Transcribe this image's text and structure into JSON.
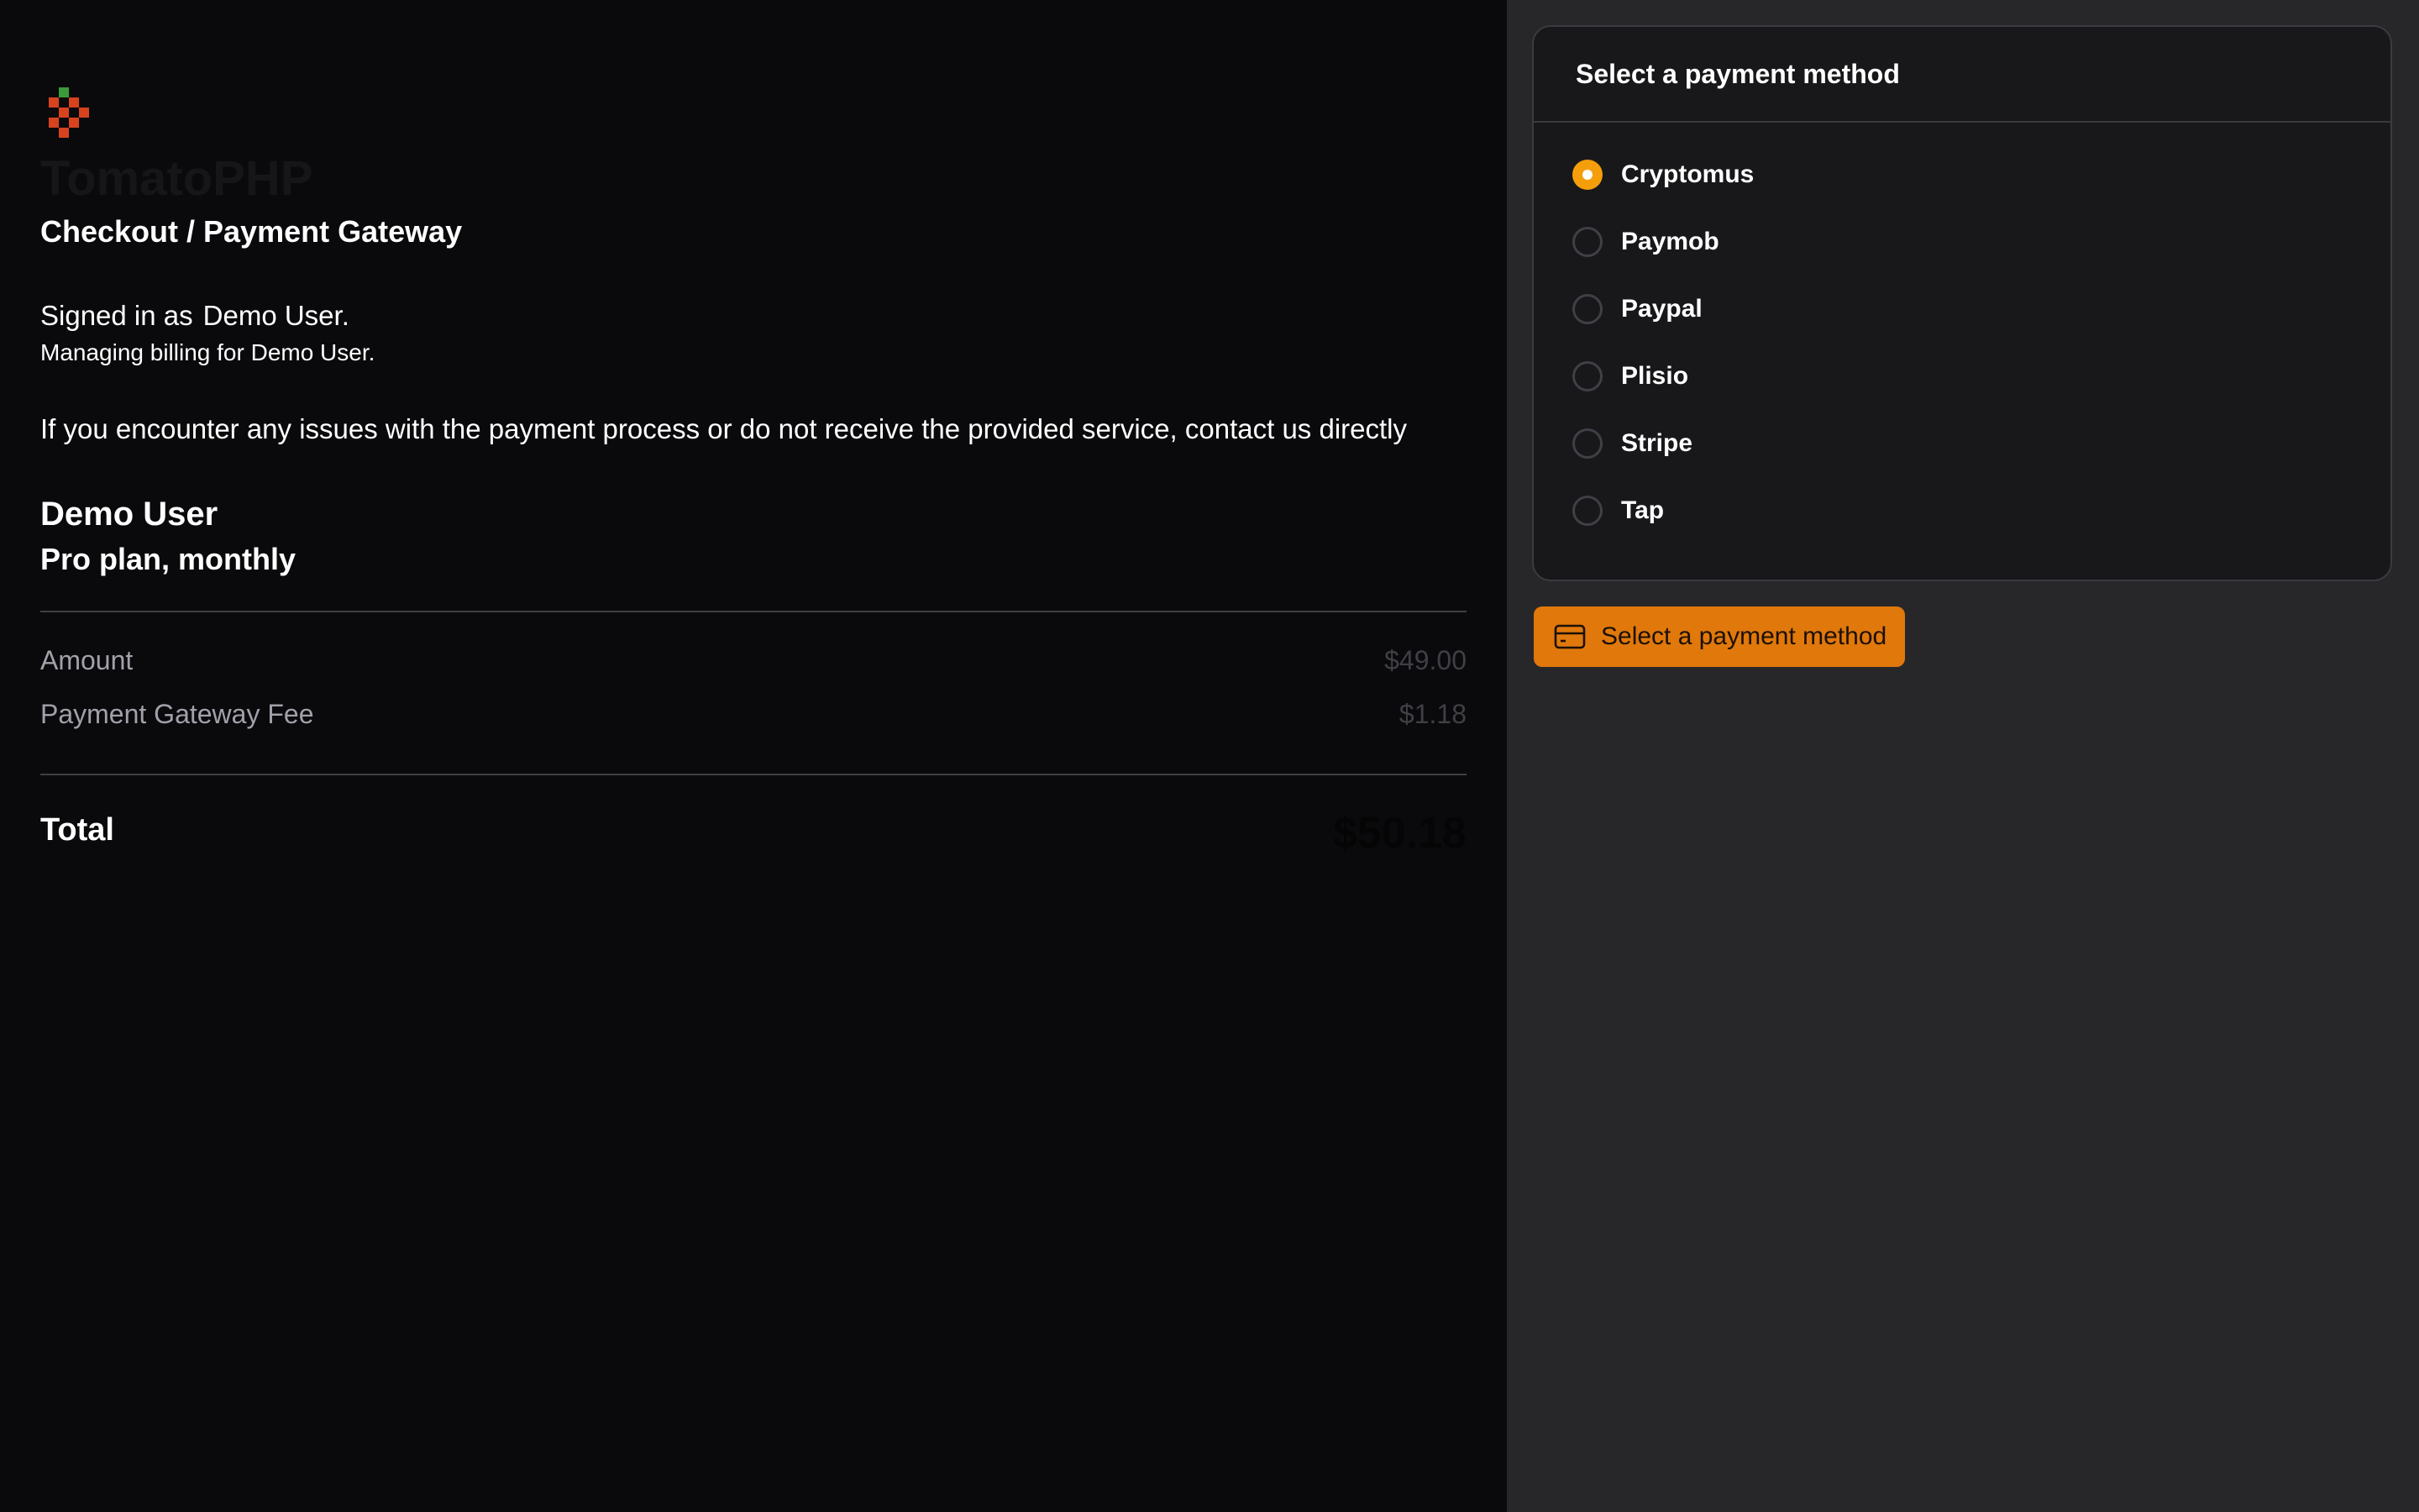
{
  "app": {
    "brand": "TomatoPHP",
    "logo_icon": "tomato-pixel-logo-icon",
    "page_title": "Checkout / Payment Gateway"
  },
  "account": {
    "signed_in_prefix": "Signed in as",
    "signed_in_user": "Demo User.",
    "managing_text": "Managing billing for Demo User."
  },
  "notice": "If you encounter any issues with the payment process or do not receive the provided service, contact us directly",
  "order": {
    "customer_name": "Demo User",
    "plan": "Pro plan, monthly",
    "amount_label": "Amount",
    "amount_value": "$49.00",
    "fee_label": "Payment Gateway Fee",
    "fee_value": "$1.18",
    "total_label": "Total",
    "total_value": "$50.18"
  },
  "payment": {
    "card_title": "Select a payment method",
    "selected": "Cryptomus",
    "methods": [
      {
        "label": "Cryptomus",
        "checked": true
      },
      {
        "label": "Paymob",
        "checked": false
      },
      {
        "label": "Paypal",
        "checked": false
      },
      {
        "label": "Plisio",
        "checked": false
      },
      {
        "label": "Stripe",
        "checked": false
      },
      {
        "label": "Tap",
        "checked": false
      }
    ],
    "button_label": "Select a payment method",
    "button_icon": "credit-card-icon"
  },
  "colors": {
    "accent": "#f59e0b",
    "button": "#e0780b",
    "left_bg": "#0a0a0c",
    "right_bg": "#27272a",
    "card_bg": "#18181b"
  }
}
